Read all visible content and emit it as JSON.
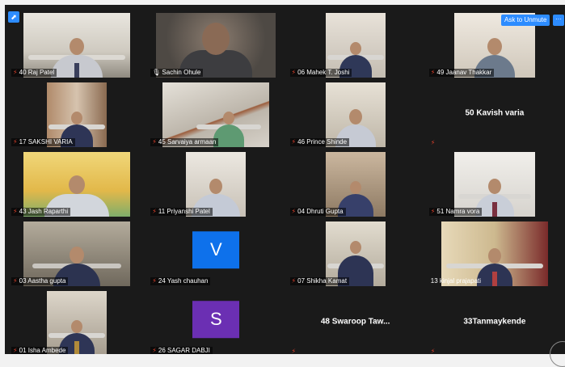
{
  "controls": {
    "ask_to_unmute": "Ask to Unmute",
    "more": "···"
  },
  "colors": {
    "accent": "#2d8cff",
    "muted_mic": "#e0402b",
    "avatar_v": "#0e71eb",
    "avatar_s": "#6b2fb3"
  },
  "participants": [
    {
      "name": "40 Raj Patel",
      "muted": true,
      "video": true
    },
    {
      "name": "Sachin Ohule",
      "muted": false,
      "video": true
    },
    {
      "name": "06 Mahek T. Joshi",
      "muted": true,
      "video": true
    },
    {
      "name": "49 Jaanav Thakkar",
      "muted": true,
      "video": true
    },
    {
      "name": "17 SAKSHI VARIA",
      "muted": true,
      "video": true
    },
    {
      "name": "45 Sarvaiya armaan",
      "muted": true,
      "video": true
    },
    {
      "name": "46 Prince Shinde",
      "muted": true,
      "video": true
    },
    {
      "name": "50 Kavish varia",
      "muted": true,
      "video": false,
      "display": "name"
    },
    {
      "name": "43 Jash Raparthi",
      "muted": true,
      "video": true
    },
    {
      "name": "11 Priyanshi Patel",
      "muted": true,
      "video": true
    },
    {
      "name": "04 Dhruti Gupta",
      "muted": true,
      "video": true
    },
    {
      "name": "51 Namra vora",
      "muted": true,
      "video": true
    },
    {
      "name": "03 Aastha gupta",
      "muted": true,
      "video": true
    },
    {
      "name": "24 Yash chauhan",
      "muted": true,
      "video": false,
      "display": "avatar",
      "initial": "V"
    },
    {
      "name": "07 Shikha Kamat",
      "muted": true,
      "video": true
    },
    {
      "name": "13 kinjal prajapati",
      "muted": false,
      "video": true,
      "no_icon": true
    },
    {
      "name": "01 Isha Ambede",
      "muted": true,
      "video": true
    },
    {
      "name": "26 SAGAR DABJI",
      "muted": true,
      "video": false,
      "display": "avatar",
      "initial": "S"
    },
    {
      "name": "48 Swaroop Taw...",
      "muted": true,
      "video": false,
      "display": "name"
    },
    {
      "name": "33Tanmaykende",
      "muted": true,
      "video": false,
      "display": "name"
    }
  ]
}
